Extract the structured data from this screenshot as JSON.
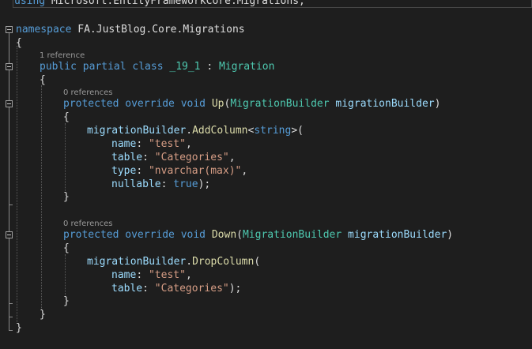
{
  "editor": {
    "top_line": {
      "kw": "using",
      "rest": " Microsoft.EntityFrameworkCore.Migrations;"
    },
    "namespace_line": {
      "kw": "namespace",
      "name": " FA.JustBlog.Core.Migrations"
    },
    "brace_open": "{",
    "brace_close": "}",
    "class_lens": "1 reference",
    "class_line": {
      "kw": "public partial class",
      "name": " _19_1",
      "sep": " : ",
      "base": "Migration"
    },
    "up": {
      "lens": "0 references",
      "kw": "protected override void",
      "name": " Up",
      "open_paren": "(",
      "param_type": "MigrationBuilder",
      "param_name": " migrationBuilder",
      "close_paren": ")",
      "call_obj": "migrationBuilder",
      "dot": ".",
      "call_method": "AddColumn",
      "lt": "<",
      "generic": "string",
      "gt_paren": ">(",
      "args": [
        {
          "name": "name",
          "colon": ": ",
          "value": "\"test\"",
          "end": ","
        },
        {
          "name": "table",
          "colon": ": ",
          "value": "\"Categories\"",
          "end": ","
        },
        {
          "name": "type",
          "colon": ": ",
          "value": "\"nvarchar(max)\"",
          "end": ","
        },
        {
          "name": "nullable",
          "colon": ": ",
          "value": "true",
          "end": ");"
        }
      ]
    },
    "down": {
      "lens": "0 references",
      "kw": "protected override void",
      "name": " Down",
      "open_paren": "(",
      "param_type": "MigrationBuilder",
      "param_name": " migrationBuilder",
      "close_paren": ")",
      "call_obj": "migrationBuilder",
      "dot": ".",
      "call_method": "DropColumn",
      "call_open": "(",
      "args": [
        {
          "name": "name",
          "colon": ": ",
          "value": "\"test\"",
          "end": ","
        },
        {
          "name": "table",
          "colon": ": ",
          "value": "\"Categories\"",
          "end": ");"
        }
      ]
    }
  },
  "colors": {
    "background": "#1e1e1e",
    "keyword": "#569cd6",
    "type": "#4ec9b0",
    "method": "#dcdcaa",
    "parameter": "#9cdcfe",
    "string": "#d69d85",
    "plain": "#dcdcdc",
    "codelens": "#999999"
  }
}
